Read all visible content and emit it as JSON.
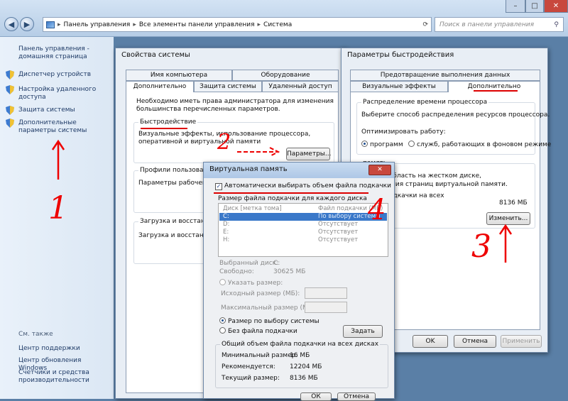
{
  "explorer": {
    "breadcrumb": [
      "Панель управления",
      "Все элементы панели управления",
      "Система"
    ],
    "search_placeholder": "Поиск в панели управления",
    "minimize": "–",
    "maximize": "□",
    "close": "✕"
  },
  "sidebar": {
    "home": "Панель управления - домашняя страница",
    "items": [
      "Диспетчер устройств",
      "Настройка удаленного доступа",
      "Защита системы",
      "Дополнительные параметры системы"
    ],
    "see_also_title": "См. также",
    "see_also": [
      "Центр поддержки",
      "Центр обновления Windows",
      "Счетчики и средства производительности"
    ]
  },
  "sysprops": {
    "title": "Свойства системы",
    "tabs_top": [
      "Имя компьютера",
      "Оборудование"
    ],
    "tabs_bottom": [
      "Дополнительно",
      "Защита системы",
      "Удаленный доступ"
    ],
    "admin_note": "Необходимо иметь права администратора для изменения большинства перечисленных параметров.",
    "perf_title": "Быстродействие",
    "perf_desc": "Визуальные эффекты, использование процессора, оперативной и виртуальной памяти",
    "params_button": "Параметры...",
    "profiles_title": "Профили пользовате",
    "profiles_desc": "Параметры рабочего с",
    "startup_title": "Загрузка и восстанов",
    "startup_desc": "Загрузка и восстанов"
  },
  "perfopts": {
    "title": "Параметры быстродействия",
    "tab_top": "Предотвращение выполнения данных",
    "tabs_bottom": [
      "Визуальные эффекты",
      "Дополнительно"
    ],
    "cpu_title": "Распределение времени процессора",
    "cpu_desc": "Выберите способ распределения ресурсов процессора.",
    "optimize_label": "Оптимизировать работу:",
    "opt_programs": "программ",
    "opt_services": "служб, работающих в фоновом режиме",
    "vm_title": "память",
    "vm_desc1": "ки - это область на жестком диске,",
    "vm_desc2": "ля хранения страниц виртуальной памяти.",
    "vm_total_label": "файла подкачки на всех",
    "vm_total_value": "8136 МБ",
    "change_button": "Изменить...",
    "ok": "OK",
    "cancel": "Отмена",
    "apply": "Применить"
  },
  "vmem": {
    "title": "Виртуальная память",
    "auto_label": "Автоматически выбирать объем файла подкачки",
    "per_disk_label": "Размер файла подкачки для каждого диска",
    "col_disk": "Диск [метка тома]",
    "col_size": "Файл подкачки (МБ)",
    "rows": [
      {
        "disk": "C:",
        "size": "По выбору системы"
      },
      {
        "disk": "D:",
        "size": "Отсутствует"
      },
      {
        "disk": "E:",
        "size": "Отсутствует"
      },
      {
        "disk": "H:",
        "size": "Отсутствует"
      }
    ],
    "selected_label": "Выбранный диск:",
    "selected_value": "C:",
    "free_label": "Свободно:",
    "free_value": "30625 МБ",
    "custom_label": "Указать размер:",
    "initial_label": "Исходный размер (МБ):",
    "max_label": "Максимальный размер (МБ):",
    "system_label": "Размер по выбору системы",
    "none_label": "Без файла подкачки",
    "set_button": "Задать",
    "total_title": "Общий объем файла подкачки на всех дисках",
    "min_label": "Минимальный размер:",
    "min_value": "16 МБ",
    "rec_label": "Рекомендуется:",
    "rec_value": "12204 МБ",
    "cur_label": "Текущий размер:",
    "cur_value": "8136 МБ",
    "ok": "ОК",
    "cancel": "Отмена"
  },
  "annotations": [
    "1",
    "2",
    "3",
    "4"
  ]
}
